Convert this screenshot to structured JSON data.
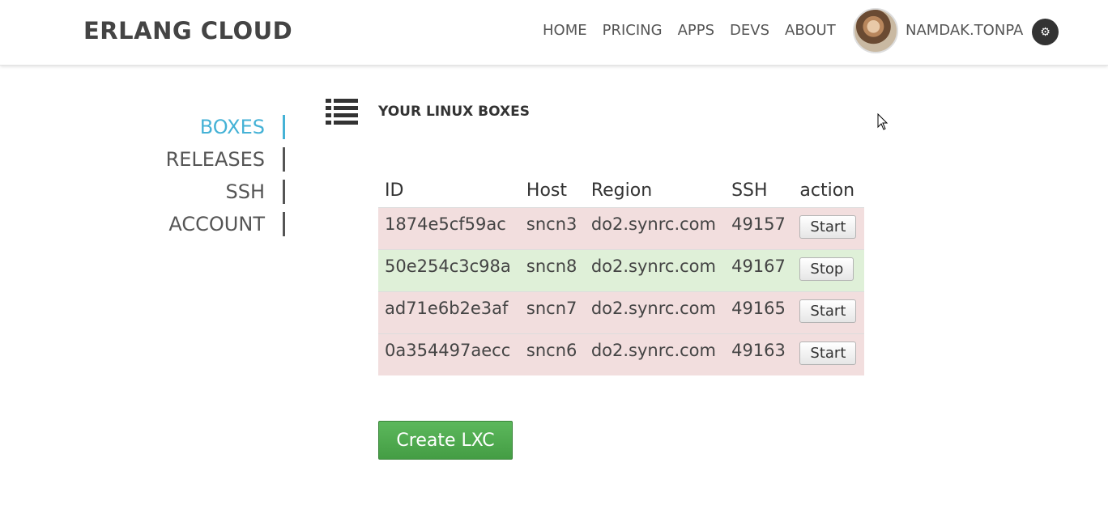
{
  "header": {
    "brand": "ERLANG CLOUD",
    "nav": [
      "HOME",
      "PRICING",
      "APPS",
      "DEVS",
      "ABOUT"
    ],
    "username": "NAMDAK.TONPA",
    "settings_icon": "gear-icon"
  },
  "sidebar": {
    "items": [
      {
        "label": "BOXES",
        "active": true
      },
      {
        "label": "RELEASES",
        "active": false
      },
      {
        "label": "SSH",
        "active": false
      },
      {
        "label": "ACCOUNT",
        "active": false
      }
    ]
  },
  "main": {
    "title": "YOUR LINUX BOXES",
    "title_icon": "list-icon",
    "table": {
      "columns": [
        "ID",
        "Host",
        "Region",
        "SSH",
        "action"
      ],
      "rows": [
        {
          "id": "1874e5cf59ac",
          "host": "sncn3",
          "region": "do2.synrc.com",
          "ssh": "49157",
          "action": "Start",
          "status": "stopped"
        },
        {
          "id": "50e254c3c98a",
          "host": "sncn8",
          "region": "do2.synrc.com",
          "ssh": "49167",
          "action": "Stop",
          "status": "running"
        },
        {
          "id": "ad71e6b2e3af",
          "host": "sncn7",
          "region": "do2.synrc.com",
          "ssh": "49165",
          "action": "Start",
          "status": "stopped"
        },
        {
          "id": "0a354497aecc",
          "host": "sncn6",
          "region": "do2.synrc.com",
          "ssh": "49163",
          "action": "Start",
          "status": "stopped"
        }
      ]
    },
    "create_button": "Create LXC"
  },
  "colors": {
    "accent": "#45b2d6",
    "stopped_row": "#f2dede",
    "running_row": "#dff0d8",
    "create_button": "#5cb85c"
  }
}
